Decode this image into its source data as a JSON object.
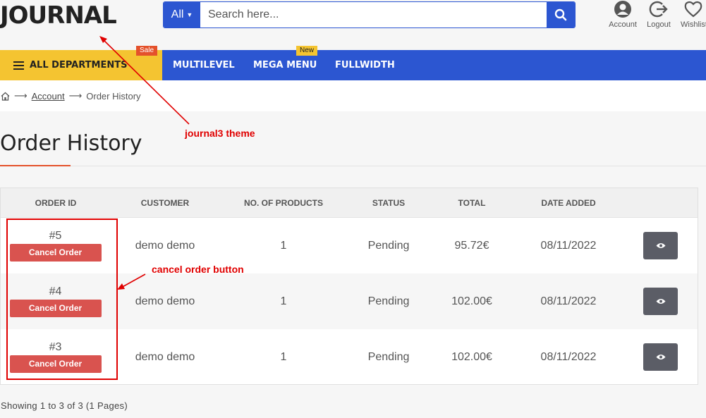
{
  "header": {
    "logo": "JOURNAL",
    "search": {
      "category": "All",
      "placeholder": "Search here..."
    },
    "links": [
      {
        "label": "Account",
        "icon": "account-icon"
      },
      {
        "label": "Logout",
        "icon": "logout-icon"
      },
      {
        "label": "Wishlist",
        "icon": "heart-icon"
      }
    ]
  },
  "nav": {
    "departments": "ALL DEPARTMENTS",
    "items": [
      "MULTILEVEL",
      "MEGA MENU",
      "FULLWIDTH"
    ],
    "badges": {
      "sale": "Sale",
      "new": "New"
    }
  },
  "breadcrumb": {
    "separator": "⟶",
    "account": "Account",
    "current": "Order History"
  },
  "page": {
    "title": "Order History"
  },
  "table": {
    "headers": [
      "ORDER ID",
      "CUSTOMER",
      "NO. OF PRODUCTS",
      "STATUS",
      "TOTAL",
      "DATE ADDED"
    ],
    "cancel_label": "Cancel Order",
    "rows": [
      {
        "id": "#5",
        "customer": "demo demo",
        "products": "1",
        "status": "Pending",
        "total": "95.72€",
        "date": "08/11/2022"
      },
      {
        "id": "#4",
        "customer": "demo demo",
        "products": "1",
        "status": "Pending",
        "total": "102.00€",
        "date": "08/11/2022"
      },
      {
        "id": "#3",
        "customer": "demo demo",
        "products": "1",
        "status": "Pending",
        "total": "102.00€",
        "date": "08/11/2022"
      }
    ]
  },
  "pagination": {
    "text": "Showing 1 to 3 of 3 (1 Pages)"
  },
  "annotations": {
    "theme_note": "journal3 theme",
    "cancel_note": "cancel order button",
    "color": "#e00000"
  },
  "colors": {
    "primary": "#2c56d1",
    "accent_yellow": "#f4c431",
    "cancel_red": "#d9534f",
    "sale_orange": "#e4512b"
  }
}
